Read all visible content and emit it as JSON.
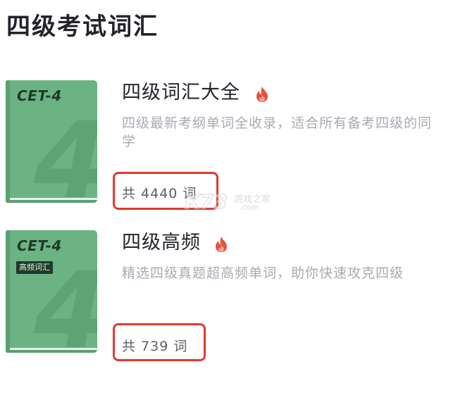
{
  "page": {
    "title": "四级考试词汇"
  },
  "books": [
    {
      "cover_label": "CET-4",
      "cover_tag": "",
      "cover_number": "4",
      "title": "四级词汇大全",
      "hot_icon": "fire-icon",
      "description": "四级最新考纲单词全收录，适合所有备考四级的同学",
      "count": "共 4440 词"
    },
    {
      "cover_label": "CET-4",
      "cover_tag": "高频词汇",
      "cover_number": "4",
      "title": "四级高频",
      "hot_icon": "fire-icon",
      "description": "精选四级真题超高频单词，助你快速攻克四级",
      "count": "共 739 词"
    }
  ],
  "watermark": {
    "logo": "K73",
    "text_cn": "游戏之家",
    "text_url": ".com"
  },
  "colors": {
    "cover_green": "#6cb384",
    "highlight_red": "#e03b2e",
    "fire_red": "#e4523f",
    "title_text": "#22232b",
    "desc_text": "#a8aab3"
  }
}
